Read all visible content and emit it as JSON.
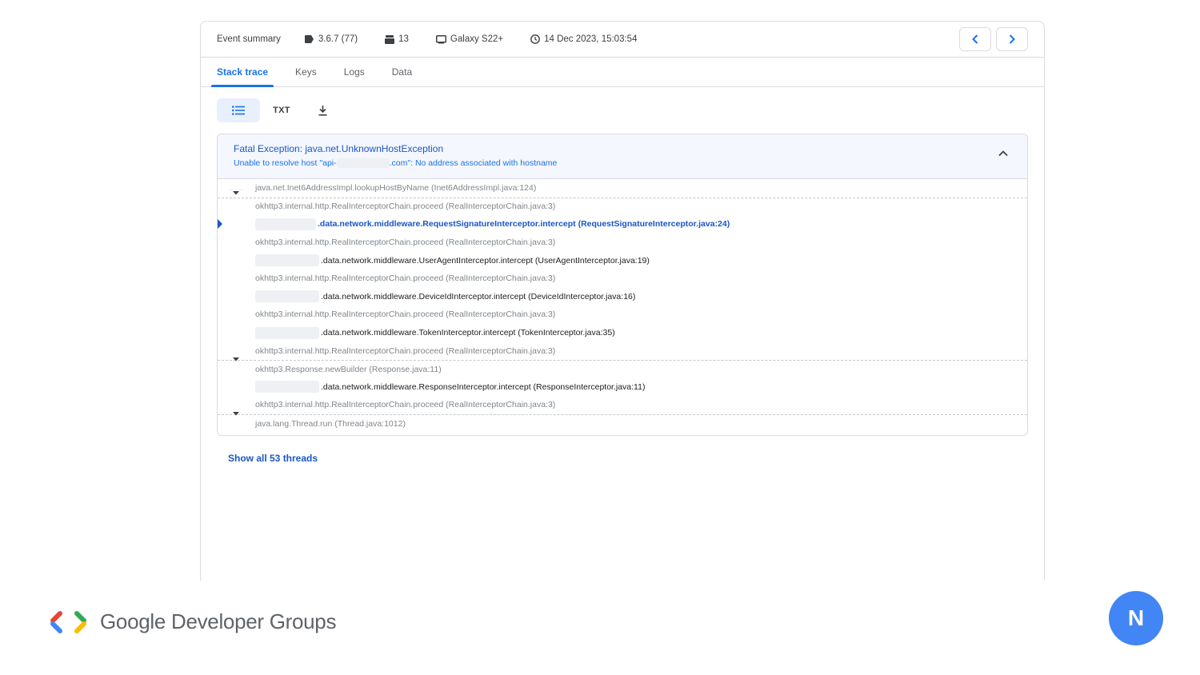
{
  "summary": {
    "title": "Event summary",
    "version": "3.6.7 (77)",
    "count": "13",
    "device": "Galaxy S22+",
    "timestamp": "14 Dec 2023, 15:03:54"
  },
  "tabs": [
    {
      "label": "Stack trace",
      "active": true
    },
    {
      "label": "Keys",
      "active": false
    },
    {
      "label": "Logs",
      "active": false
    },
    {
      "label": "Data",
      "active": false
    }
  ],
  "toolbar": {
    "txt_label": "TXT"
  },
  "exception": {
    "title": "Fatal Exception: java.net.UnknownHostException",
    "message_prefix": "Unable to resolve host \"api-",
    "message_suffix": ".com\": No address associated with hostname"
  },
  "frames": [
    {
      "text": "java.net.Inet6AddressImpl.lookupHostByName (Inet6AddressImpl.java:124)",
      "style": "dim"
    },
    {
      "text": "okhttp3.internal.http.RealInterceptorChain.proceed (RealInterceptorChain.java:3)",
      "style": "dim"
    },
    {
      "text": ".data.network.middleware.RequestSignatureInterceptor.intercept (RequestSignatureInterceptor.java:24)",
      "style": "highlight"
    },
    {
      "text": "okhttp3.internal.http.RealInterceptorChain.proceed (RealInterceptorChain.java:3)",
      "style": "dim"
    },
    {
      "text": ".data.network.middleware.UserAgentInterceptor.intercept (UserAgentInterceptor.java:19)",
      "style": "dark"
    },
    {
      "text": "okhttp3.internal.http.RealInterceptorChain.proceed (RealInterceptorChain.java:3)",
      "style": "dim"
    },
    {
      "text": ".data.network.middleware.DeviceIdInterceptor.intercept (DeviceIdInterceptor.java:16)",
      "style": "dark"
    },
    {
      "text": "okhttp3.internal.http.RealInterceptorChain.proceed (RealInterceptorChain.java:3)",
      "style": "dim"
    },
    {
      "text": ".data.network.middleware.TokenInterceptor.intercept (TokenInterceptor.java:35)",
      "style": "dark"
    },
    {
      "text": "okhttp3.internal.http.RealInterceptorChain.proceed (RealInterceptorChain.java:3)",
      "style": "dim"
    },
    {
      "text": "okhttp3.Response.newBuilder (Response.java:11)",
      "style": "dim"
    },
    {
      "text": ".data.network.middleware.ResponseInterceptor.intercept (ResponseInterceptor.java:11)",
      "style": "dark"
    },
    {
      "text": "okhttp3.internal.http.RealInterceptorChain.proceed (RealInterceptorChain.java:3)",
      "style": "dim"
    },
    {
      "text": "java.lang.Thread.run (Thread.java:1012)",
      "style": "dim"
    }
  ],
  "show_threads": "Show all 53 threads",
  "branding": {
    "text": "Google Developer Groups"
  },
  "avatar": {
    "initial": "N"
  },
  "colors": {
    "accent": "#1a73e8",
    "avatar": "#4285f4"
  },
  "icons": [
    "tag-icon",
    "layers-icon",
    "device-icon",
    "clock-icon",
    "chevron-left-icon",
    "chevron-right-icon",
    "list-view-icon",
    "download-icon",
    "collapse-icon",
    "expand-caret-icon",
    "current-frame-marker"
  ]
}
